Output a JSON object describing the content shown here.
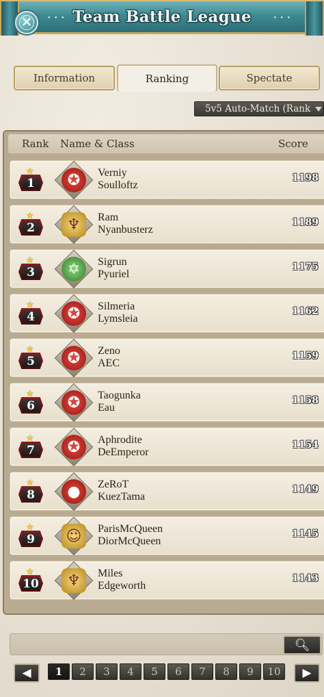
{
  "header": {
    "title": "Team Battle League",
    "close_icon": "close-icon"
  },
  "tabs": [
    {
      "label": "Information",
      "active": false
    },
    {
      "label": "Ranking",
      "active": true
    },
    {
      "label": "Spectate",
      "active": false
    }
  ],
  "dropdown": {
    "selected": "5v5 Auto-Match (Rank"
  },
  "table": {
    "headers": {
      "rank": "Rank",
      "name_class": "Name & Class",
      "score": "Score"
    },
    "rows": [
      {
        "rank": "1",
        "name": "Verniy",
        "team": "Soulloftz",
        "score": "1198",
        "class_icon": "red-star-crest-icon"
      },
      {
        "rank": "2",
        "name": "Ram",
        "team": "Nyanbusterz",
        "score": "1189",
        "class_icon": "gold-wing-crest-icon"
      },
      {
        "rank": "3",
        "name": "Sigrun",
        "team": "Pyuriel",
        "score": "1175",
        "class_icon": "green-hexagram-crest-icon"
      },
      {
        "rank": "4",
        "name": "Silmeria",
        "team": "Lymsleia",
        "score": "1162",
        "class_icon": "red-star-crest-icon"
      },
      {
        "rank": "5",
        "name": "Zeno",
        "team": "AEC",
        "score": "1159",
        "class_icon": "red-star-crest-icon"
      },
      {
        "rank": "6",
        "name": "Taogunka",
        "team": "Eau",
        "score": "1158",
        "class_icon": "red-star-crest-icon"
      },
      {
        "rank": "7",
        "name": "Aphrodite",
        "team": "DeEmperor",
        "score": "1154",
        "class_icon": "red-star-crest-icon"
      },
      {
        "rank": "8",
        "name": "ZeRoT",
        "team": "KuezTama",
        "score": "1149",
        "class_icon": "red-bomb-crest-icon"
      },
      {
        "rank": "9",
        "name": "ParisMcQueen",
        "team": "DiorMcQueen",
        "score": "1145",
        "class_icon": "gold-face-crest-icon"
      },
      {
        "rank": "10",
        "name": "Miles",
        "team": "Edgeworth",
        "score": "1143",
        "class_icon": "gold-wing-crest-icon"
      }
    ]
  },
  "search": {
    "value": "",
    "icon": "search-icon"
  },
  "pagination": {
    "prev_icon": "left-arrow-icon",
    "next_icon": "right-arrow-icon",
    "pages": [
      "1",
      "2",
      "3",
      "4",
      "5",
      "6",
      "7",
      "8",
      "9",
      "10"
    ],
    "current": "1"
  }
}
